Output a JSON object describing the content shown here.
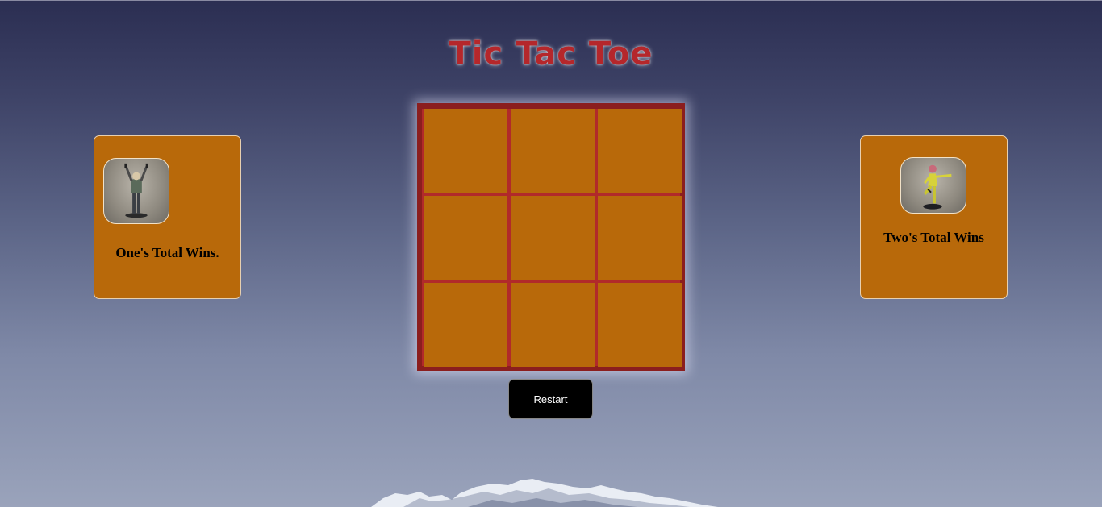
{
  "title": "Tic Tac Toe",
  "board": {
    "cells": [
      "",
      "",
      "",
      "",
      "",
      "",
      "",
      "",
      ""
    ]
  },
  "restart_label": "Restart",
  "player_one": {
    "wins_label": "One's Total Wins."
  },
  "player_two": {
    "wins_label": "Two's Total Wins"
  },
  "colors": {
    "cell": "#b8690a",
    "grid_lines": "#b12a2a",
    "title": "#b5272b",
    "card": "#b8690a"
  }
}
